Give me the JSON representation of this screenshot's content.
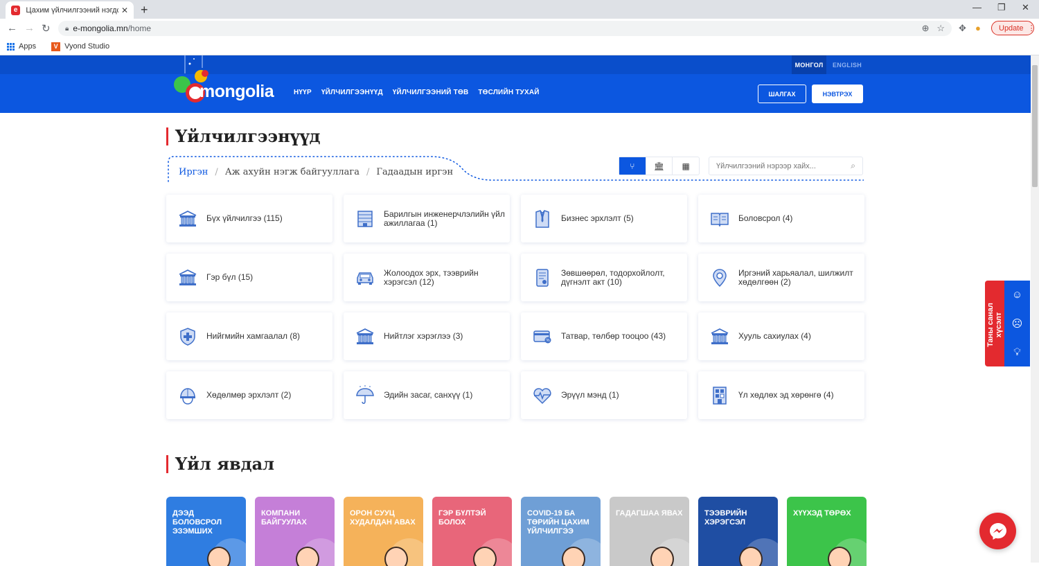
{
  "browser": {
    "tab_title": "Цахим үйлчилгээний нэгдсэн п",
    "url_host": "e-mongolia.mn",
    "url_path": "/home",
    "update_label": "Update",
    "bookmarks": [
      {
        "label": "Apps"
      },
      {
        "label": "Vyond Studio"
      }
    ]
  },
  "header": {
    "lang_mn": "МОНГОЛ",
    "lang_en": "ENGLISH",
    "logo": "mongolia",
    "nav": [
      "НҮҮР",
      "ҮЙЛЧИЛГЭЭНҮҮД",
      "ҮЙЛЧИЛГЭЭНИЙ ТӨВ",
      "ТӨСЛИЙН ТУХАЙ"
    ],
    "search_label": "ШАЛГАХ",
    "login_label": "НЭВТРЭХ"
  },
  "services": {
    "title": "Үйлчилгээнүүд",
    "breadcrumb": [
      "Иргэн",
      "Аж ахуйн нэгж байгууллага",
      "Гадаадын иргэн"
    ],
    "search_placeholder": "Үйлчилгээний нэрээр хайх...",
    "cards": [
      {
        "label": "Бүх үйлчилгээ (115)",
        "icon": "building-icon"
      },
      {
        "label": "Барилгын инженерчлэлийн үйл ажиллагаа (1)",
        "icon": "office-icon"
      },
      {
        "label": "Бизнес эрхлэлт (5)",
        "icon": "suit-icon"
      },
      {
        "label": "Боловсрол (4)",
        "icon": "book-icon"
      },
      {
        "label": "Гэр бүл (15)",
        "icon": "building-icon"
      },
      {
        "label": "Жолоодох эрх, тээврийн хэрэгсэл (12)",
        "icon": "car-icon"
      },
      {
        "label": "Зөвшөөрөл, тодорхойлолт, дүгнэлт акт (10)",
        "icon": "document-icon"
      },
      {
        "label": "Иргэний харьяалал, шилжилт хөдөлгөөн (2)",
        "icon": "location-pin-icon"
      },
      {
        "label": "Нийгмийн хамгаалал (8)",
        "icon": "shield-icon"
      },
      {
        "label": "Нийтлэг хэрэглээ (3)",
        "icon": "building-icon"
      },
      {
        "label": "Татвар, төлбөр тооцоо (43)",
        "icon": "credit-card-icon"
      },
      {
        "label": "Хууль сахиулах (4)",
        "icon": "building-icon"
      },
      {
        "label": "Хөдөлмөр эрхлэлт (2)",
        "icon": "helmet-icon"
      },
      {
        "label": "Эдийн засаг, санхүү (1)",
        "icon": "umbrella-icon"
      },
      {
        "label": "Эрүүл мэнд (1)",
        "icon": "heart-icon"
      },
      {
        "label": "Үл хөдлөх эд хөрөнгө (4)",
        "icon": "property-icon"
      }
    ]
  },
  "events": {
    "title": "Үйл явдал",
    "items": [
      {
        "label": "ДЭЭД БОЛОВСРОЛ ЭЗЭМШИХ",
        "color": "#2f7de1"
      },
      {
        "label": "КОМПАНИ БАЙГУУЛАХ",
        "color": "#c57fd8"
      },
      {
        "label": "ОРОН СУУЦ ХУДАЛДАН АВАХ",
        "color": "#f5b25a"
      },
      {
        "label": "ГЭР БҮЛТЭЙ БОЛОХ",
        "color": "#e8667a"
      },
      {
        "label": "COVID-19 БА ТӨРИЙН ЦАХИМ ҮЙЛЧИЛГЭЭ",
        "color": "#6f9fd6"
      },
      {
        "label": "ГАДАГШАА ЯВАХ",
        "color": "#c9c9c9"
      },
      {
        "label": "ТЭЭВРИЙН ХЭРЭГСЭЛ",
        "color": "#1f4ea3"
      },
      {
        "label": "ХҮҮХЭД ТӨРӨХ",
        "color": "#3cc44a"
      }
    ]
  },
  "feedback": {
    "label": "Таны санал хүсэлт"
  },
  "colors": {
    "primary": "#0c57e0",
    "accent": "#e32a2f"
  }
}
